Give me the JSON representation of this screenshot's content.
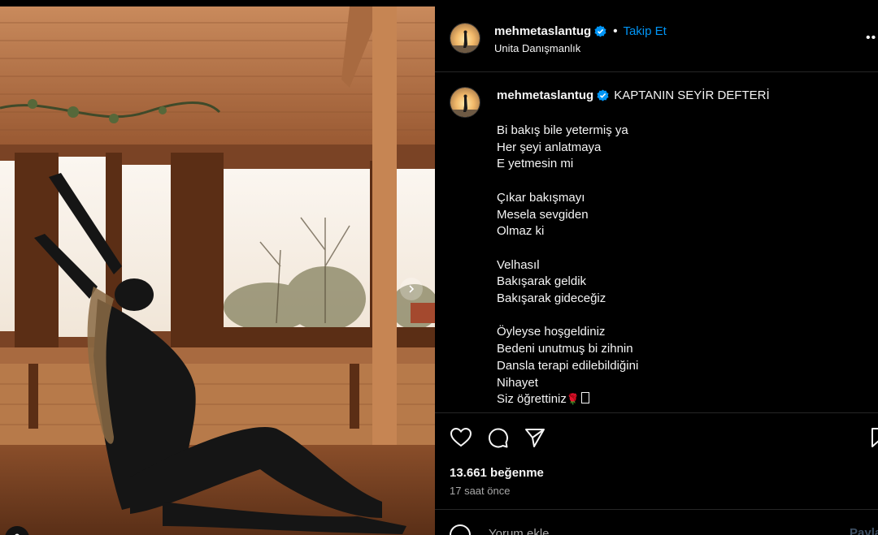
{
  "post": {
    "username": "mehmetaslantug",
    "follow_label": "Takip Et",
    "separator": "•",
    "location": "Unita Danışmanlık"
  },
  "caption": {
    "username": "mehmetaslantug",
    "title": "KAPTANIN SEYİR DEFTERİ",
    "stanzas": [
      [
        "Bi bakış bile yetermiş ya",
        "Her şeyi anlatmaya",
        "E yetmesin mi"
      ],
      [
        "Çıkar bakışmayı",
        "Mesela sevgiden",
        "Olmaz ki"
      ],
      [
        "Velhasıl",
        "Bakışarak geldik",
        "Bakışarak gideceğiz"
      ],
      [
        "Öyleyse hoşgeldiniz",
        "Bedeni unutmuş bi zihnin",
        "Dansla terapi edilebildiğini",
        "Nihayet",
        "Siz öğrettiniz"
      ]
    ],
    "last_line_emoji": "🌹"
  },
  "stats": {
    "likes": "13.661 beğenme",
    "time": "17 saat önce"
  },
  "comment": {
    "placeholder": "Yorum ekle...",
    "post_label": "Paylaş"
  },
  "icons": {
    "like": "heart-icon",
    "comment": "comment-icon",
    "share": "send-icon",
    "save": "bookmark-icon",
    "more": "more-icon",
    "verified": "verified-badge-icon",
    "next": "chevron-right-icon",
    "tag": "user-tag-icon",
    "emoji": "emoji-icon"
  },
  "colors": {
    "background": "#000000",
    "accent": "#0095f6",
    "verified": "#0095f6",
    "muted": "#a8a8a8",
    "divider": "#262626"
  }
}
